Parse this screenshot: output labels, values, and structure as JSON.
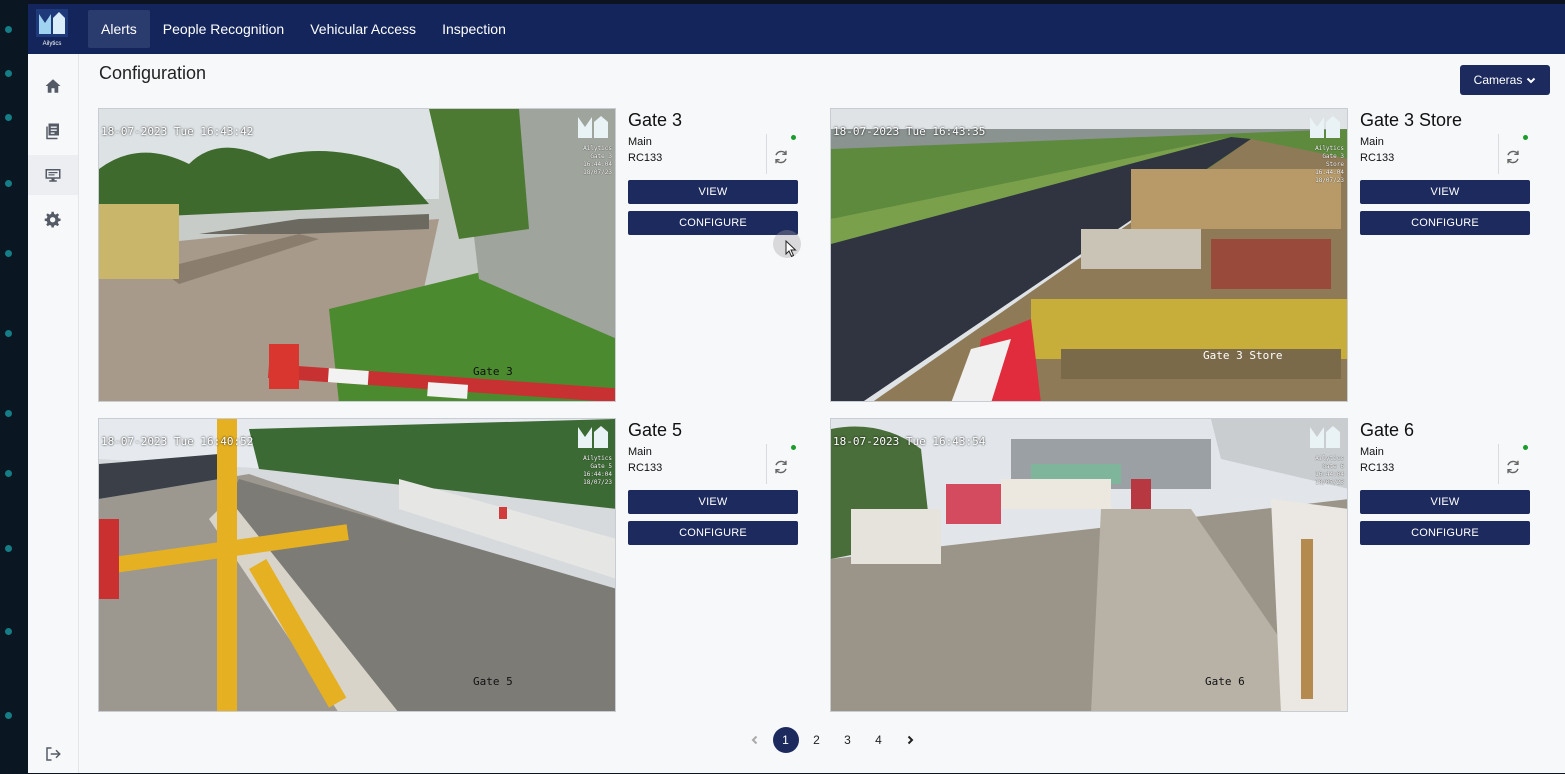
{
  "app": {
    "brand": "Ailytics"
  },
  "nav": {
    "items": [
      {
        "label": "Alerts",
        "active": true
      },
      {
        "label": "People Recognition",
        "active": false
      },
      {
        "label": "Vehicular Access",
        "active": false
      },
      {
        "label": "Inspection",
        "active": false
      }
    ]
  },
  "sidebar": {
    "items": [
      {
        "icon": "home-icon"
      },
      {
        "icon": "report-icon"
      },
      {
        "icon": "monitor-icon",
        "active": true
      },
      {
        "icon": "gear-icon"
      }
    ],
    "logout_icon": "logout-icon"
  },
  "page": {
    "title": "Configuration",
    "cameras_button": "Cameras"
  },
  "cameras": [
    {
      "name": "Gate 3",
      "site": "Main",
      "id": "RC133",
      "timestamp": "18-07-2023 Tue 16:43:42",
      "wm_lines": [
        "Ailytics",
        "Gate 3",
        "16:44:04",
        "18/07/23"
      ],
      "caption": "Gate 3",
      "status": "online",
      "view_label": "VIEW",
      "configure_label": "CONFIGURE"
    },
    {
      "name": "Gate 3 Store",
      "site": "Main",
      "id": "RC133",
      "timestamp": "18-07-2023 Tue 16:43:35",
      "wm_lines": [
        "Ailytics",
        "Gate 3 Store",
        "16:44:04",
        "18/07/23"
      ],
      "caption": "Gate 3 Store",
      "status": "online",
      "view_label": "VIEW",
      "configure_label": "CONFIGURE"
    },
    {
      "name": "Gate 5",
      "site": "Main",
      "id": "RC133",
      "timestamp": "18-07-2023 Tue 16:40:52",
      "wm_lines": [
        "Ailytics",
        "Gate 5",
        "16:44:04",
        "18/07/23"
      ],
      "caption": "Gate 5",
      "status": "online",
      "view_label": "VIEW",
      "configure_label": "CONFIGURE"
    },
    {
      "name": "Gate 6",
      "site": "Main",
      "id": "RC133",
      "timestamp": "18-07-2023 Tue 16:43:54",
      "wm_lines": [
        "Ailytics",
        "Gate 6",
        "16:44:04",
        "18/07/23"
      ],
      "caption": "Gate 6",
      "status": "online",
      "view_label": "VIEW",
      "configure_label": "CONFIGURE"
    }
  ],
  "pagination": {
    "pages": [
      "1",
      "2",
      "3",
      "4"
    ],
    "current": "1"
  },
  "colors": {
    "navbar": "#13255b",
    "button": "#1d2a5e",
    "status_online": "#1a9d2a",
    "background": "#f7f8fa"
  }
}
